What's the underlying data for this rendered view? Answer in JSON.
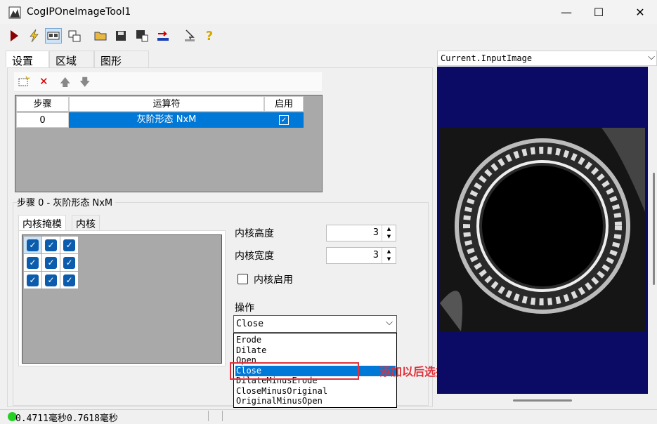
{
  "window": {
    "title": "CogIPOneImageTool1",
    "minimize_icon": "minimize-icon",
    "maximize_icon": "maximize-icon",
    "close_icon": "close-icon"
  },
  "toolbar": {
    "icons": [
      "run-icon",
      "lightning-icon",
      "display-icon",
      "window-icon",
      "open-folder-icon",
      "save-icon",
      "save-settings-icon",
      "reset-icon",
      "pick-icon",
      "help-icon"
    ]
  },
  "tabs": [
    "设置",
    "区域",
    "图形"
  ],
  "steps_toolbar": {
    "icons": [
      "new-step-icon",
      "delete-step-icon",
      "move-up-icon",
      "move-down-icon"
    ]
  },
  "grid": {
    "headers": [
      "步骤",
      "运算符",
      "启用"
    ],
    "rows": [
      {
        "step": "0",
        "operator": "灰阶形态 NxM",
        "enabled": true
      }
    ]
  },
  "section": {
    "label": "步骤 0 - 灰阶形态 NxM"
  },
  "subtabs": [
    "内核掩模",
    "内核"
  ],
  "kernel_mask": [
    [
      true,
      true,
      true
    ],
    [
      true,
      true,
      true
    ],
    [
      true,
      true,
      true
    ]
  ],
  "kernel": {
    "height_label": "内核高度",
    "height_value": "3",
    "width_label": "内核宽度",
    "width_value": "3",
    "enable_label": "内核启用",
    "enabled": false
  },
  "operation": {
    "label": "操作",
    "selected": "Close",
    "options": [
      "Erode",
      "Dilate",
      "Open",
      "Close",
      "DilateMinusErode",
      "CloseMinusOriginal",
      "OriginalMinusOpen"
    ],
    "highlighted_index": 3
  },
  "annotation": "添加以后选择这个",
  "image_panel": {
    "selected": "Current.InputImage"
  },
  "status": {
    "text": "0.4711毫秒0.7618毫秒"
  },
  "colors": {
    "selection": "#0078d7",
    "annotation": "#e0303a",
    "image_background": "#0b0b66",
    "status_ok": "#25d025"
  }
}
